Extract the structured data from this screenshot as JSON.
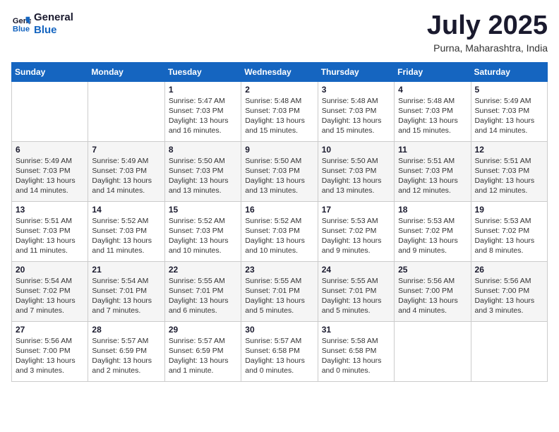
{
  "logo": {
    "text_general": "General",
    "text_blue": "Blue"
  },
  "title": "July 2025",
  "location": "Purna, Maharashtra, India",
  "headers": [
    "Sunday",
    "Monday",
    "Tuesday",
    "Wednesday",
    "Thursday",
    "Friday",
    "Saturday"
  ],
  "weeks": [
    [
      {
        "day": "",
        "info": ""
      },
      {
        "day": "",
        "info": ""
      },
      {
        "day": "1",
        "info": "Sunrise: 5:47 AM\nSunset: 7:03 PM\nDaylight: 13 hours\nand 16 minutes."
      },
      {
        "day": "2",
        "info": "Sunrise: 5:48 AM\nSunset: 7:03 PM\nDaylight: 13 hours\nand 15 minutes."
      },
      {
        "day": "3",
        "info": "Sunrise: 5:48 AM\nSunset: 7:03 PM\nDaylight: 13 hours\nand 15 minutes."
      },
      {
        "day": "4",
        "info": "Sunrise: 5:48 AM\nSunset: 7:03 PM\nDaylight: 13 hours\nand 15 minutes."
      },
      {
        "day": "5",
        "info": "Sunrise: 5:49 AM\nSunset: 7:03 PM\nDaylight: 13 hours\nand 14 minutes."
      }
    ],
    [
      {
        "day": "6",
        "info": "Sunrise: 5:49 AM\nSunset: 7:03 PM\nDaylight: 13 hours\nand 14 minutes."
      },
      {
        "day": "7",
        "info": "Sunrise: 5:49 AM\nSunset: 7:03 PM\nDaylight: 13 hours\nand 14 minutes."
      },
      {
        "day": "8",
        "info": "Sunrise: 5:50 AM\nSunset: 7:03 PM\nDaylight: 13 hours\nand 13 minutes."
      },
      {
        "day": "9",
        "info": "Sunrise: 5:50 AM\nSunset: 7:03 PM\nDaylight: 13 hours\nand 13 minutes."
      },
      {
        "day": "10",
        "info": "Sunrise: 5:50 AM\nSunset: 7:03 PM\nDaylight: 13 hours\nand 13 minutes."
      },
      {
        "day": "11",
        "info": "Sunrise: 5:51 AM\nSunset: 7:03 PM\nDaylight: 13 hours\nand 12 minutes."
      },
      {
        "day": "12",
        "info": "Sunrise: 5:51 AM\nSunset: 7:03 PM\nDaylight: 13 hours\nand 12 minutes."
      }
    ],
    [
      {
        "day": "13",
        "info": "Sunrise: 5:51 AM\nSunset: 7:03 PM\nDaylight: 13 hours\nand 11 minutes."
      },
      {
        "day": "14",
        "info": "Sunrise: 5:52 AM\nSunset: 7:03 PM\nDaylight: 13 hours\nand 11 minutes."
      },
      {
        "day": "15",
        "info": "Sunrise: 5:52 AM\nSunset: 7:03 PM\nDaylight: 13 hours\nand 10 minutes."
      },
      {
        "day": "16",
        "info": "Sunrise: 5:52 AM\nSunset: 7:03 PM\nDaylight: 13 hours\nand 10 minutes."
      },
      {
        "day": "17",
        "info": "Sunrise: 5:53 AM\nSunset: 7:02 PM\nDaylight: 13 hours\nand 9 minutes."
      },
      {
        "day": "18",
        "info": "Sunrise: 5:53 AM\nSunset: 7:02 PM\nDaylight: 13 hours\nand 9 minutes."
      },
      {
        "day": "19",
        "info": "Sunrise: 5:53 AM\nSunset: 7:02 PM\nDaylight: 13 hours\nand 8 minutes."
      }
    ],
    [
      {
        "day": "20",
        "info": "Sunrise: 5:54 AM\nSunset: 7:02 PM\nDaylight: 13 hours\nand 7 minutes."
      },
      {
        "day": "21",
        "info": "Sunrise: 5:54 AM\nSunset: 7:01 PM\nDaylight: 13 hours\nand 7 minutes."
      },
      {
        "day": "22",
        "info": "Sunrise: 5:55 AM\nSunset: 7:01 PM\nDaylight: 13 hours\nand 6 minutes."
      },
      {
        "day": "23",
        "info": "Sunrise: 5:55 AM\nSunset: 7:01 PM\nDaylight: 13 hours\nand 5 minutes."
      },
      {
        "day": "24",
        "info": "Sunrise: 5:55 AM\nSunset: 7:01 PM\nDaylight: 13 hours\nand 5 minutes."
      },
      {
        "day": "25",
        "info": "Sunrise: 5:56 AM\nSunset: 7:00 PM\nDaylight: 13 hours\nand 4 minutes."
      },
      {
        "day": "26",
        "info": "Sunrise: 5:56 AM\nSunset: 7:00 PM\nDaylight: 13 hours\nand 3 minutes."
      }
    ],
    [
      {
        "day": "27",
        "info": "Sunrise: 5:56 AM\nSunset: 7:00 PM\nDaylight: 13 hours\nand 3 minutes."
      },
      {
        "day": "28",
        "info": "Sunrise: 5:57 AM\nSunset: 6:59 PM\nDaylight: 13 hours\nand 2 minutes."
      },
      {
        "day": "29",
        "info": "Sunrise: 5:57 AM\nSunset: 6:59 PM\nDaylight: 13 hours\nand 1 minute."
      },
      {
        "day": "30",
        "info": "Sunrise: 5:57 AM\nSunset: 6:58 PM\nDaylight: 13 hours\nand 0 minutes."
      },
      {
        "day": "31",
        "info": "Sunrise: 5:58 AM\nSunset: 6:58 PM\nDaylight: 13 hours\nand 0 minutes."
      },
      {
        "day": "",
        "info": ""
      },
      {
        "day": "",
        "info": ""
      }
    ]
  ]
}
